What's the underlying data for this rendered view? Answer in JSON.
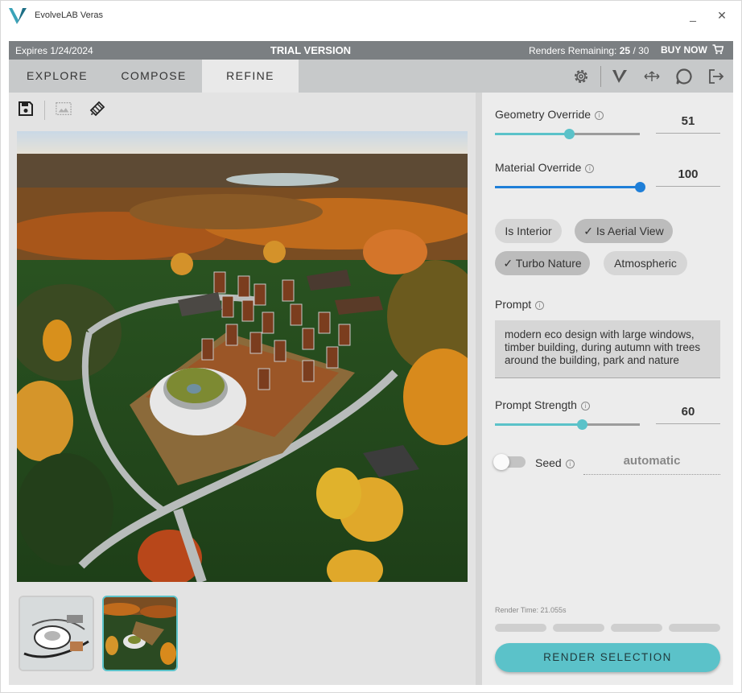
{
  "window": {
    "title": "EvolveLAB Veras",
    "minimize_glyph": "_",
    "close_glyph": "✕"
  },
  "trial_bar": {
    "expires": "Expires 1/24/2024",
    "version": "TRIAL VERSION",
    "renders_label": "Renders Remaining:",
    "renders_remaining": "25",
    "renders_total": "/ 30",
    "buy_now": "BUY NOW"
  },
  "nav": {
    "tabs": [
      {
        "label": "EXPLORE",
        "active": false
      },
      {
        "label": "COMPOSE",
        "active": false
      },
      {
        "label": "REFINE",
        "active": true
      }
    ],
    "icons": [
      "gear-icon",
      "veras-logo-icon",
      "move-arrows-icon",
      "chat-bubble-icon",
      "logout-icon"
    ]
  },
  "controls": {
    "geometry_override": {
      "label": "Geometry Override",
      "value": "51",
      "fraction": 0.51
    },
    "material_override": {
      "label": "Material Override",
      "value": "100",
      "fraction": 1.0
    },
    "chips": [
      {
        "label": "Is Interior",
        "checked": false
      },
      {
        "label": "Is Aerial View",
        "checked": true
      },
      {
        "label": "Turbo Nature",
        "checked": true
      },
      {
        "label": "Atmospheric",
        "checked": false
      }
    ],
    "prompt": {
      "label": "Prompt",
      "text": "modern eco design with large windows, timber building, during autumn with trees around the building, park and nature"
    },
    "prompt_strength": {
      "label": "Prompt Strength",
      "value": "60",
      "fraction": 0.6
    },
    "seed": {
      "label": "Seed",
      "value": "automatic",
      "enabled": false
    },
    "render_time": "Render Time: 21.055s",
    "render_button": "RENDER SELECTION"
  },
  "colors": {
    "accent": "#5bc2c9",
    "slider_teal": "#5bc2c9",
    "slider_blue": "#1f7fd8",
    "trial_bar": "#7b7f82"
  }
}
